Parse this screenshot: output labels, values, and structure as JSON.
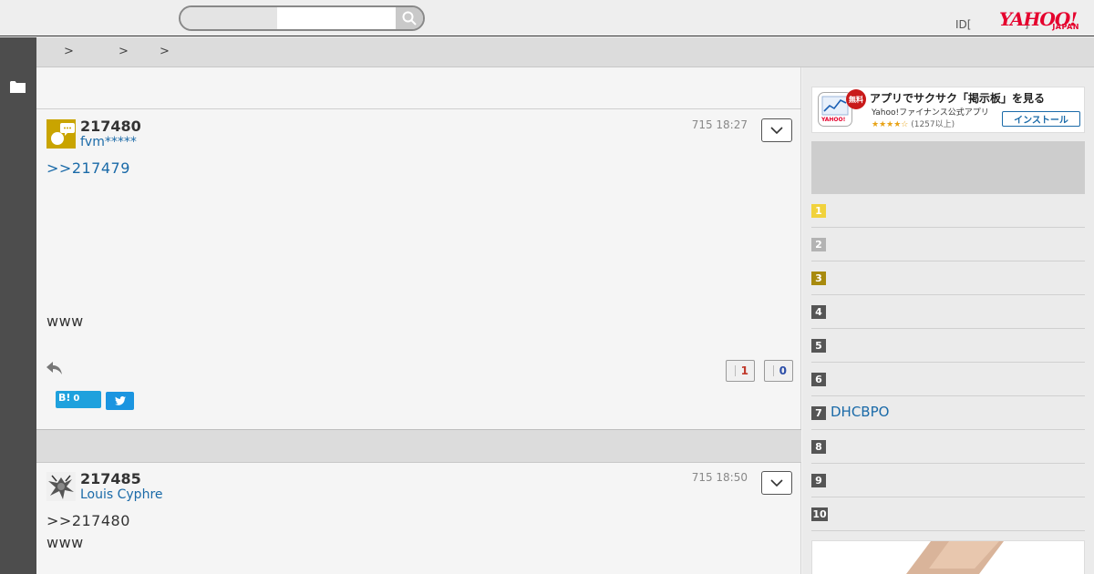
{
  "header": {
    "search_placeholder": "",
    "id_text": "ID[",
    "mini_text": "]",
    "logo_text": "YAHOO!",
    "logo_sub": "JAPAN"
  },
  "breadcrumb": [
    "",
    "",
    ""
  ],
  "breadcrumb_separator": ">",
  "posts": [
    {
      "number": "217480",
      "user": "fvm*****",
      "time": "715 18:27",
      "link": ">>217479",
      "text": "www",
      "likes": "1",
      "dislikes": "0",
      "hatena_label": "B!",
      "hatena_count": "0"
    },
    {
      "number": "217485",
      "user": "Louis Cyphre",
      "time": "715 18:50",
      "quote": ">>217480",
      "text": "www"
    }
  ],
  "app_banner": {
    "badge": "無料",
    "title": "アプリでサクサク「掲示板」を見る",
    "subtitle": "Yahoo!ファイナンス公式アプリ",
    "stars": "★★★★☆",
    "reviews": "(1257以上)",
    "install_label": "インストール",
    "icon_logo": "YAHOO!"
  },
  "ranking": [
    {
      "rank": "1",
      "title": ""
    },
    {
      "rank": "2",
      "title": ""
    },
    {
      "rank": "3",
      "title": ""
    },
    {
      "rank": "4",
      "title": ""
    },
    {
      "rank": "5",
      "title": ""
    },
    {
      "rank": "6",
      "title": ""
    },
    {
      "rank": "7",
      "title": "DHCBPO"
    },
    {
      "rank": "8",
      "title": ""
    },
    {
      "rank": "9",
      "title": ""
    },
    {
      "rank": "10",
      "title": ""
    }
  ],
  "colors": {
    "link": "#1a6aa8",
    "brand_red": "#e5002d",
    "rank_gold": "#f1d23c",
    "rank_silver": "#b3b3b3",
    "rank_bronze": "#a88a0e",
    "rank_default": "#555555",
    "like": "#c0392b",
    "dislike": "#2c4ea8"
  }
}
